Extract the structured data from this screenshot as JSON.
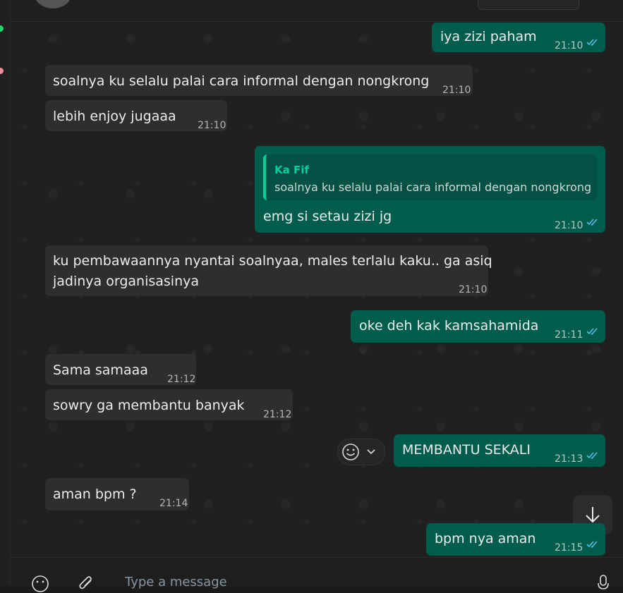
{
  "composer": {
    "placeholder": "Type a message"
  },
  "messages": [
    {
      "dir": "out",
      "text": "iya zizi paham",
      "time": "21:10",
      "read": true
    },
    {
      "dir": "in",
      "text": "soalnya ku selalu palai cara informal dengan nongkrong",
      "time": "21:10"
    },
    {
      "dir": "in",
      "text": "lebih enjoy jugaaa",
      "time": "21:10"
    },
    {
      "dir": "out",
      "text": "emg si setau zizi jg",
      "time": "21:10",
      "read": true,
      "quote": {
        "author": "Ka Fif",
        "text": "soalnya ku selalu palai cara informal dengan nongkrong"
      }
    },
    {
      "dir": "in",
      "text_line1": "ku pembawaannya nyantai soalnyaa, males terlalu kaku.. ga asiq",
      "text_line2": "jadinya organisasinya",
      "time": "21:10"
    },
    {
      "dir": "out",
      "text": "oke deh kak kamsahamida",
      "time": "21:11",
      "read": true
    },
    {
      "dir": "in",
      "text": "Sama samaaa",
      "time": "21:12"
    },
    {
      "dir": "in",
      "text": "sowry ga membantu banyak",
      "time": "21:12"
    },
    {
      "dir": "out",
      "text": "MEMBANTU SEKALI",
      "time": "21:13",
      "read": true
    },
    {
      "dir": "in",
      "text": "aman bpm ?",
      "time": "21:14"
    },
    {
      "dir": "out",
      "text": "bpm nya aman",
      "time": "21:15",
      "read": true
    }
  ],
  "colors": {
    "incoming": "#2e2e2e",
    "outgoing": "#005c4b",
    "read_ticks": "#53bdeb",
    "accent": "#06cf9c"
  }
}
